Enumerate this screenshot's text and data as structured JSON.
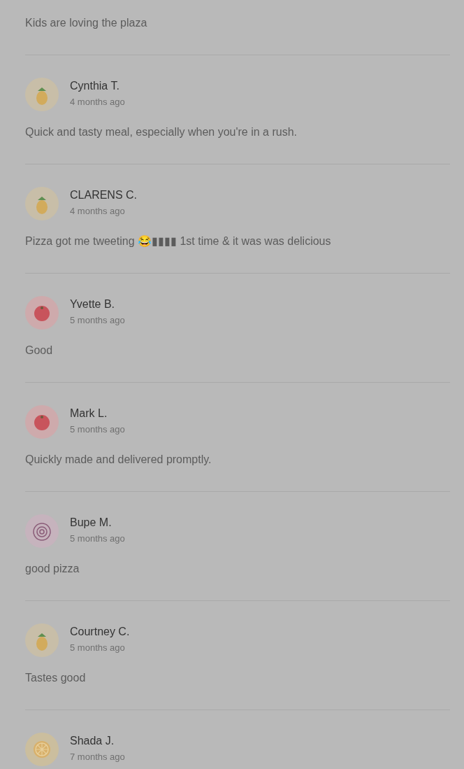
{
  "reviews": [
    {
      "text": "Kids are loving the plaza"
    },
    {
      "name": "Cynthia T.",
      "time": "4 months ago",
      "avatar": {
        "kind": "pineapple"
      },
      "text": "Quick and tasty meal, especially when you're in a rush."
    },
    {
      "name": "CLARENS C.",
      "time": "4 months ago",
      "avatar": {
        "kind": "pineapple"
      },
      "text": "Pizza got me tweeting 😂▮▮▮▮ 1st time & it was was delicious"
    },
    {
      "name": "Yvette B.",
      "time": "5 months ago",
      "avatar": {
        "kind": "tomato"
      },
      "text": "Good"
    },
    {
      "name": "Mark L.",
      "time": "5 months ago",
      "avatar": {
        "kind": "tomato"
      },
      "text": "Quickly made and delivered promptly."
    },
    {
      "name": "Bupe M.",
      "time": "5 months ago",
      "avatar": {
        "kind": "onion"
      },
      "text": "good pizza"
    },
    {
      "name": "Courtney C.",
      "time": "5 months ago",
      "avatar": {
        "kind": "pineapple"
      },
      "text": "Tastes good"
    },
    {
      "name": "Shada J.",
      "time": "7 months ago",
      "avatar": {
        "kind": "citrus"
      }
    }
  ]
}
